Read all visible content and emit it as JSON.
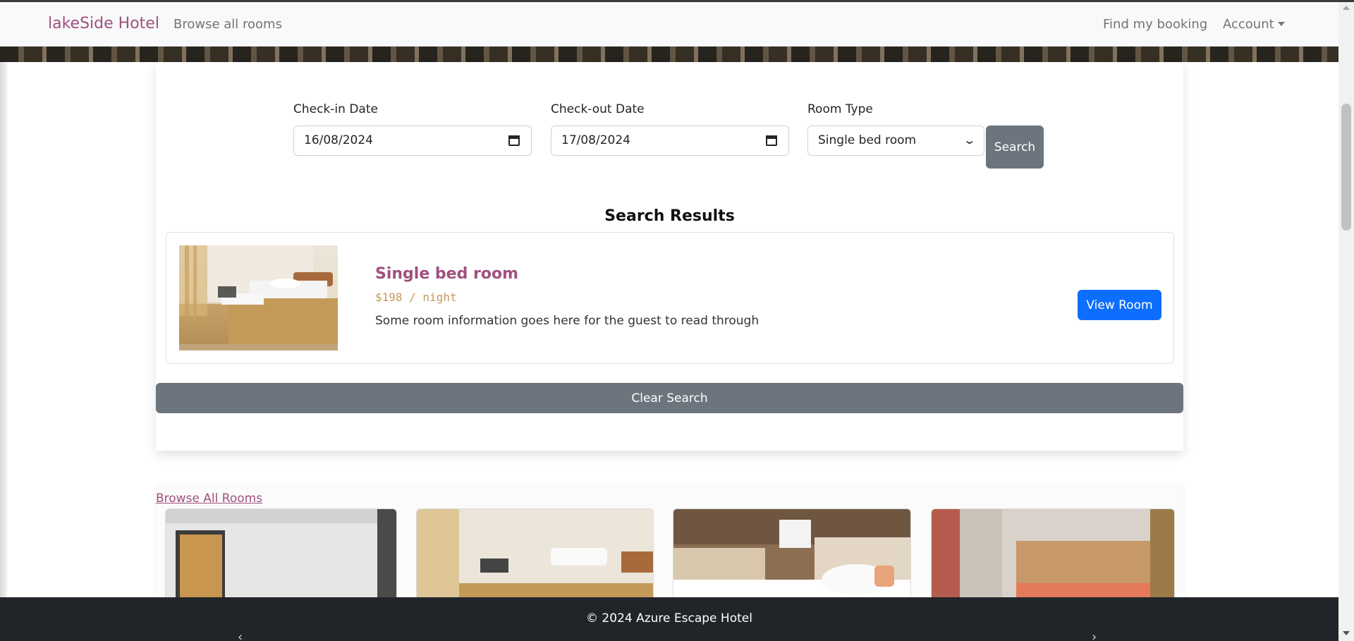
{
  "navbar": {
    "brand": "lakeSide Hotel",
    "browse_link": "Browse all rooms",
    "find_booking": "Find my booking",
    "account": "Account"
  },
  "search_form": {
    "checkin_label": "Check-in Date",
    "checkin_value": "16/08/2024",
    "checkout_label": "Check-out Date",
    "checkout_value": "17/08/2024",
    "room_type_label": "Room Type",
    "room_type_value": "Single bed room",
    "search_button": "Search"
  },
  "results": {
    "title": "Search Results",
    "items": [
      {
        "name": "Single bed room",
        "price": "$198 / night",
        "description": "Some room information goes here for the guest to read through",
        "view_button": "View Room"
      }
    ],
    "clear_button": "Clear Search"
  },
  "browse": {
    "link": "Browse All Rooms"
  },
  "footer": {
    "text": "© 2024 Azure Escape Hotel",
    "prev_arrow": "‹",
    "next_arrow": "›"
  },
  "colors": {
    "brand": "#a0507e",
    "price": "#c59a5c",
    "primary_button": "#0d6efd",
    "secondary_button": "#6c757d",
    "footer_bg": "#212529"
  }
}
